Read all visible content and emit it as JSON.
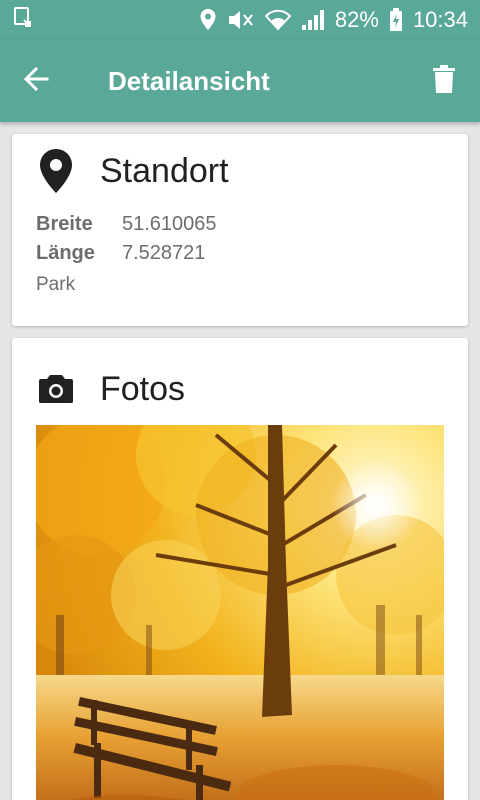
{
  "status_bar": {
    "battery": "82%",
    "time": "10:34"
  },
  "toolbar": {
    "title": "Detailansicht",
    "back_icon": "arrow-back-icon",
    "delete_icon": "trash-icon"
  },
  "location_card": {
    "title": "Standort",
    "icon": "map-pin-icon",
    "latitude_label": "Breite",
    "latitude_value": "51.610065",
    "longitude_label": "Länge",
    "longitude_value": "7.528721",
    "place": "Park"
  },
  "photos_card": {
    "title": "Fotos",
    "icon": "camera-icon",
    "photo_subject": "autumn park with tree and bench"
  },
  "colors": {
    "primary": "#5aa898",
    "background": "#e6e6e6",
    "card": "#ffffff"
  }
}
